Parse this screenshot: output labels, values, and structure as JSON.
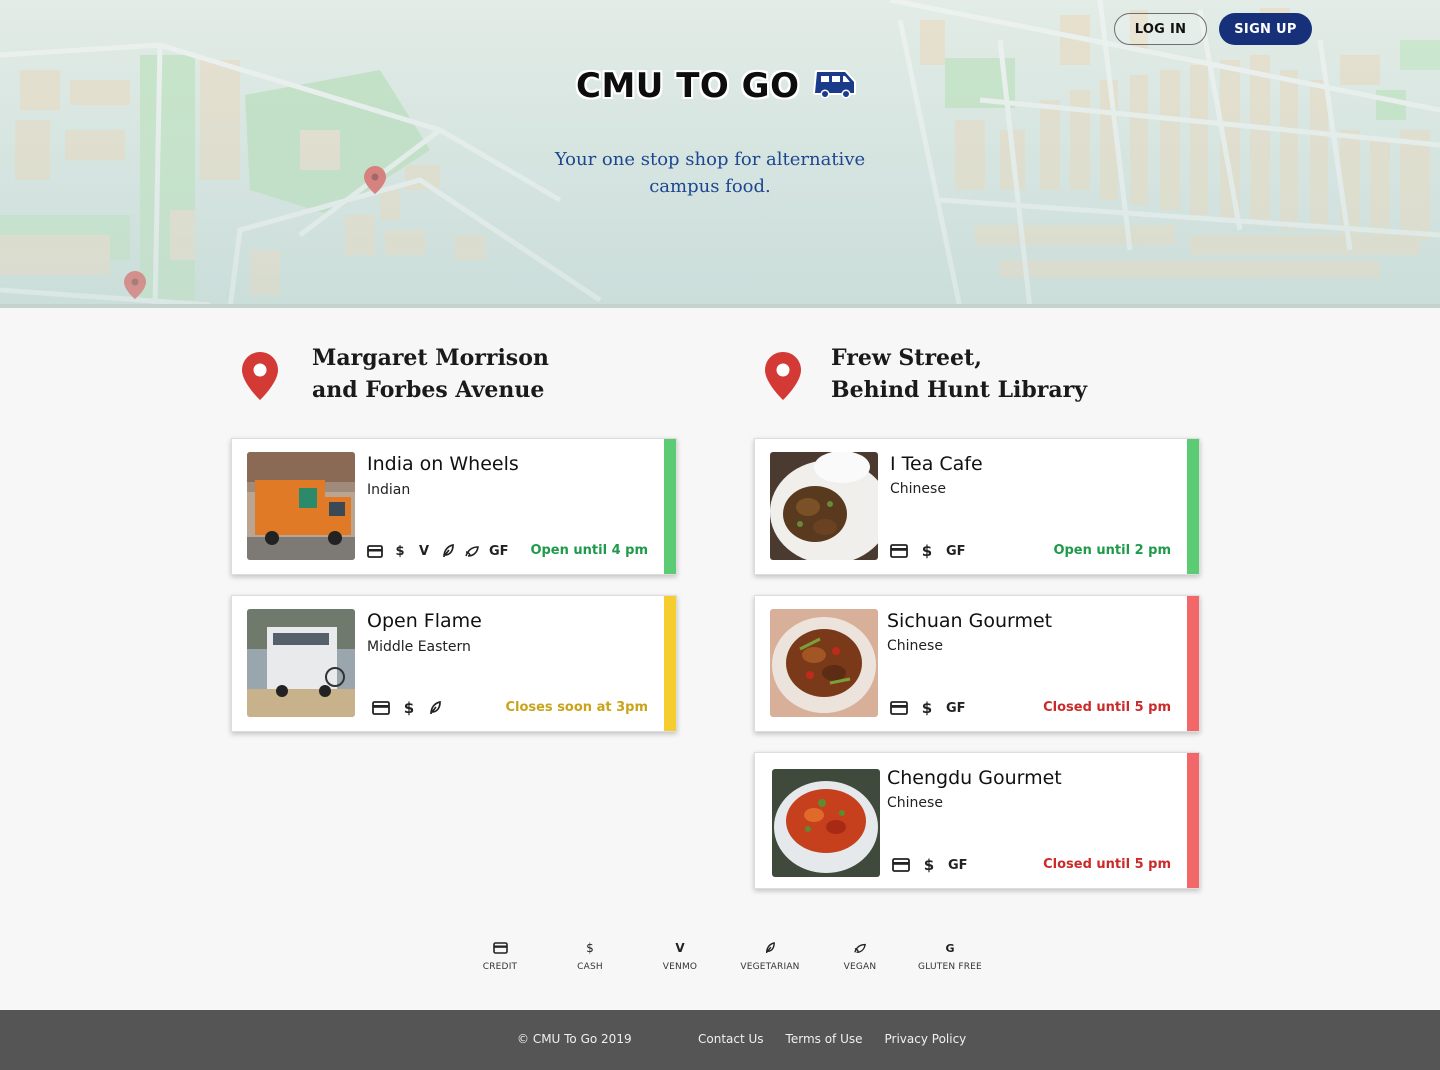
{
  "header": {
    "logo_text": "CMU TO GO",
    "tagline": "Your one stop shop for alternative campus food.",
    "login_label": "LOG IN",
    "signup_label": "SIGN UP"
  },
  "locations": [
    {
      "title_line1": "Margaret Morrison",
      "title_line2": "and Forbes Avenue",
      "trucks": [
        {
          "name": "India on Wheels",
          "cuisine": "Indian",
          "payment": [
            "credit-icon",
            "cash-icon",
            "venmo-icon",
            "vegetarian-icon",
            "vegan-icon"
          ],
          "gf": "GF",
          "status": "Open until 4 pm",
          "status_color": "#1f9a4a",
          "stripe_color": "#5ccc74"
        },
        {
          "name": "Open Flame",
          "cuisine": "Middle Eastern",
          "payment": [
            "credit-icon",
            "cash-icon",
            "vegetarian-icon"
          ],
          "gf": "",
          "status": "Closes soon at 3pm",
          "status_color": "#c9a41a",
          "stripe_color": "#f6cd2f"
        }
      ]
    },
    {
      "title_line1": "Frew Street,",
      "title_line2": "Behind Hunt Library",
      "trucks": [
        {
          "name": "I Tea Cafe",
          "cuisine": "Chinese",
          "payment": [
            "credit-icon",
            "cash-icon"
          ],
          "gf": "GF",
          "status": "Open until 2 pm",
          "status_color": "#1f9a4a",
          "stripe_color": "#5ccc74"
        },
        {
          "name": "Sichuan Gourmet",
          "cuisine": "Chinese",
          "payment": [
            "credit-icon",
            "cash-icon"
          ],
          "gf": "GF",
          "status": "Closed until 5 pm",
          "status_color": "#cc2a2a",
          "stripe_color": "#f26868"
        },
        {
          "name": "Chengdu Gourmet",
          "cuisine": "Chinese",
          "payment": [
            "credit-icon",
            "cash-icon"
          ],
          "gf": "GF",
          "status": "Closed until 5 pm",
          "status_color": "#cc2a2a",
          "stripe_color": "#f26868"
        }
      ]
    }
  ],
  "legend": [
    {
      "icon": "credit-icon",
      "label": "CREDIT"
    },
    {
      "icon": "cash-icon",
      "label": "CASH"
    },
    {
      "icon": "venmo-icon",
      "label": "VENMO"
    },
    {
      "icon": "vegetarian-icon",
      "label": "VEGETARIAN"
    },
    {
      "icon": "vegan-icon",
      "label": "VEGAN"
    },
    {
      "icon": "gluten-free-icon",
      "label": "GLUTEN FREE",
      "glyph": "G"
    }
  ],
  "footer": {
    "copyright": "© CMU To Go 2019",
    "links": [
      "Contact Us",
      "Terms of Use",
      "Privacy Policy"
    ]
  },
  "colors": {
    "brand_blue": "#16307a",
    "pin_red": "#d33a36",
    "open_green": "#1f9a4a",
    "soon_yellow": "#c9a41a",
    "closed_red": "#cc2a2a"
  }
}
